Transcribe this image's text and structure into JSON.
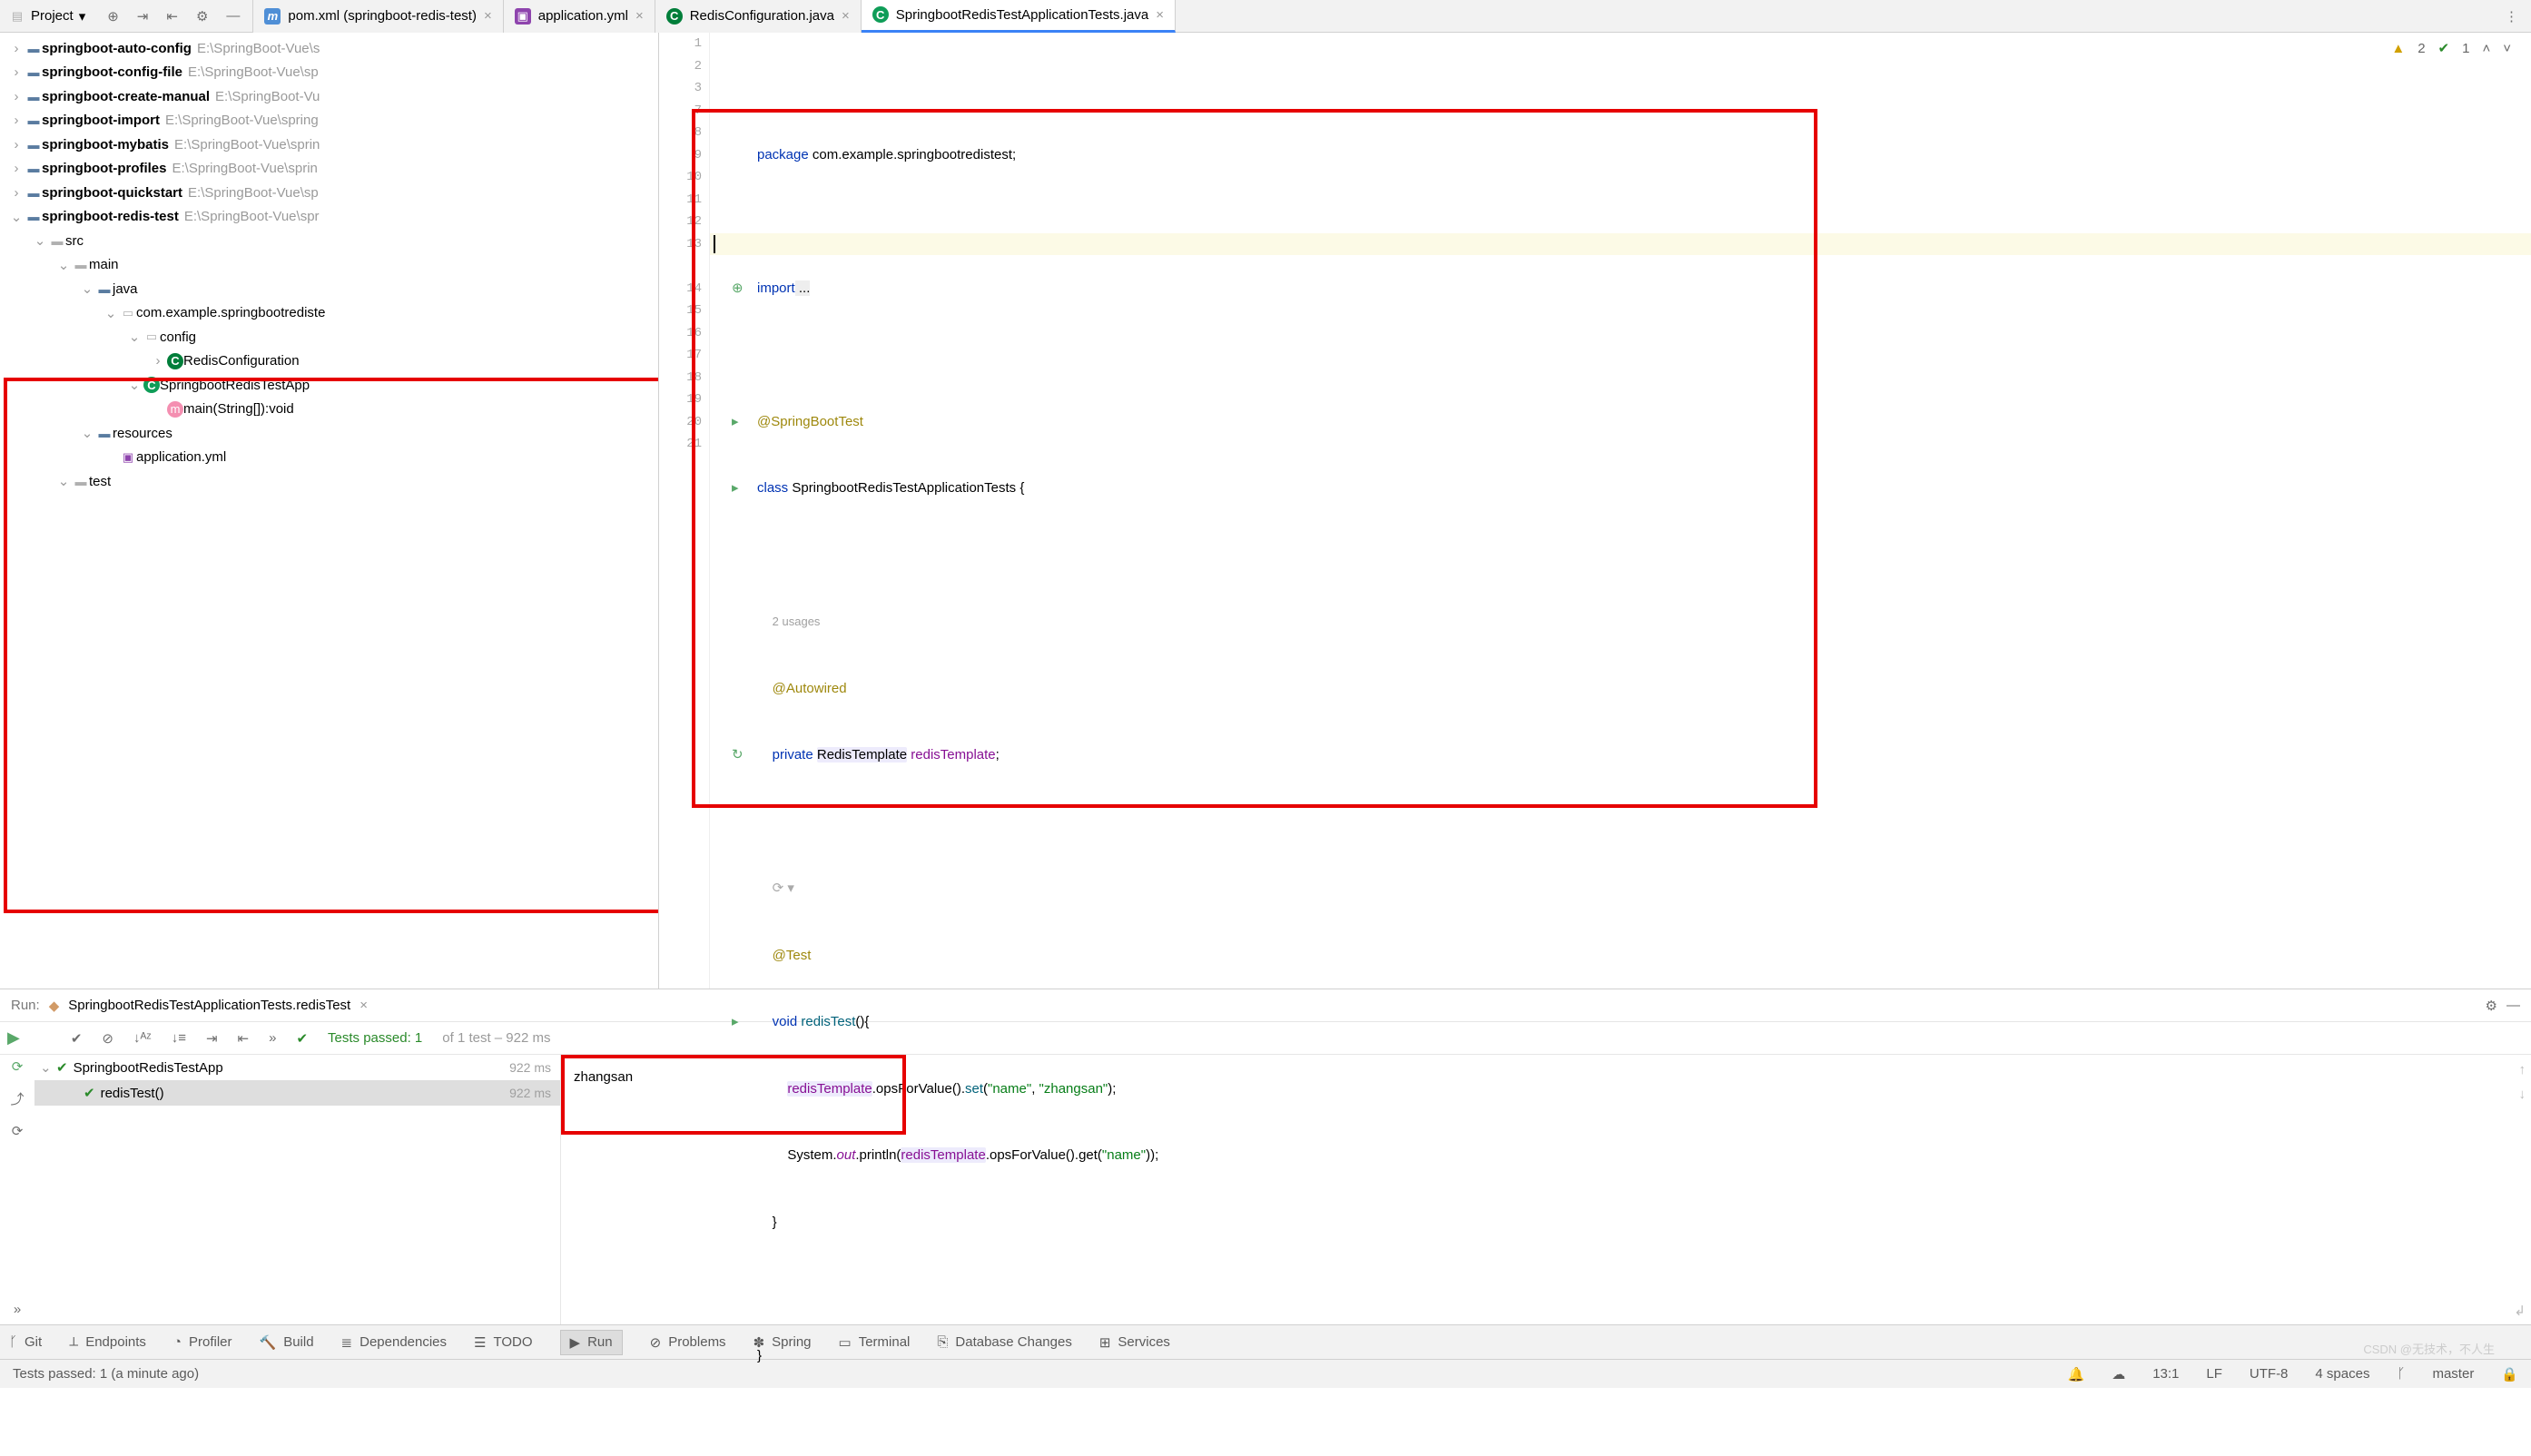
{
  "project": {
    "label": "Project"
  },
  "tabs": [
    {
      "icon": "m",
      "label": "pom.xml (springboot-redis-test)"
    },
    {
      "icon": "y",
      "label": "application.yml"
    },
    {
      "icon": "c",
      "label": "RedisConfiguration.java"
    },
    {
      "icon": "c2",
      "label": "SpringbootRedisTestApplicationTests.java",
      "active": true
    }
  ],
  "tree": [
    {
      "depth": 0,
      "chev": "›",
      "icon": "fold-b",
      "label": "springboot-auto-config",
      "bold": true,
      "hint": "E:\\SpringBoot-Vue\\s"
    },
    {
      "depth": 0,
      "chev": "›",
      "icon": "fold-b",
      "label": "springboot-config-file",
      "bold": true,
      "hint": "E:\\SpringBoot-Vue\\sp"
    },
    {
      "depth": 0,
      "chev": "›",
      "icon": "fold-b",
      "label": "springboot-create-manual",
      "bold": true,
      "hint": "E:\\SpringBoot-Vu"
    },
    {
      "depth": 0,
      "chev": "›",
      "icon": "fold-b",
      "label": "springboot-import",
      "bold": true,
      "hint": "E:\\SpringBoot-Vue\\spring"
    },
    {
      "depth": 0,
      "chev": "›",
      "icon": "fold-b",
      "label": "springboot-mybatis",
      "bold": true,
      "hint": "E:\\SpringBoot-Vue\\sprin"
    },
    {
      "depth": 0,
      "chev": "›",
      "icon": "fold-b",
      "label": "springboot-profiles",
      "bold": true,
      "hint": "E:\\SpringBoot-Vue\\sprin"
    },
    {
      "depth": 0,
      "chev": "›",
      "icon": "fold-b",
      "label": "springboot-quickstart",
      "bold": true,
      "hint": "E:\\SpringBoot-Vue\\sp"
    },
    {
      "depth": 0,
      "chev": "⌄",
      "icon": "fold-b",
      "label": "springboot-redis-test",
      "bold": true,
      "hint": "E:\\SpringBoot-Vue\\spr"
    },
    {
      "depth": 1,
      "chev": "⌄",
      "icon": "fold",
      "label": "src"
    },
    {
      "depth": 2,
      "chev": "⌄",
      "icon": "fold",
      "label": "main"
    },
    {
      "depth": 3,
      "chev": "⌄",
      "icon": "fold-b",
      "label": "java"
    },
    {
      "depth": 4,
      "chev": "⌄",
      "icon": "pkg",
      "label": "com.example.springbootrediste"
    },
    {
      "depth": 5,
      "chev": "⌄",
      "icon": "pkg",
      "label": "config"
    },
    {
      "depth": 6,
      "chev": "›",
      "icon": "c",
      "label": "RedisConfiguration"
    },
    {
      "depth": 5,
      "chev": "⌄",
      "icon": "c2",
      "label": "SpringbootRedisTestApp"
    },
    {
      "depth": 6,
      "chev": "",
      "icon": "mth",
      "label": "main(String[]):void"
    },
    {
      "depth": 3,
      "chev": "⌄",
      "icon": "fold-b",
      "label": "resources"
    },
    {
      "depth": 4,
      "chev": "",
      "icon": "y",
      "label": "application.yml"
    },
    {
      "depth": 2,
      "chev": "⌄",
      "icon": "fold",
      "label": "test"
    }
  ],
  "gutter_lines": [
    "1",
    "2",
    "3",
    "7",
    "8",
    "9",
    "10",
    "11",
    "12",
    "13",
    "",
    "14",
    "15",
    "16",
    "17",
    "18",
    "19",
    "20",
    "21"
  ],
  "code": {
    "package_kw": "package",
    "package": " com.example.springbootredistest;",
    "import_kw": "import",
    "import_dots": " ...",
    "ann_sbt": "@SpringBootTest",
    "class_kw": "class ",
    "class_name": "SpringbootRedisTestApplicationTests {",
    "usages": "2 usages",
    "ann_aw": "@Autowired",
    "private_kw": "private ",
    "rt_type": "RedisTemplate",
    "rt_name": " redisTemplate",
    "semi": ";",
    "ann_test": "@Test",
    "void_kw": "void ",
    "method": "redisTest",
    "paren_brace": "(){",
    "rt_call": "redisTemplate",
    "ofv": ".opsForValue().",
    "set_m": "set",
    "set_args_open": "(",
    "str_name": "\"name\"",
    "comma": ", ",
    "str_zhang": "\"zhangsan\"",
    "set_close": ");",
    "sys": "System.",
    "out": "out",
    "println": ".println(",
    "rt_call2": "redisTemplate",
    "ofv2": ".opsForValue().get(",
    "str_name2": "\"name\"",
    "close2": "));",
    "brace1": "}",
    "brace2": "}"
  },
  "inspection": {
    "warn_count": "2",
    "ok_count": "1"
  },
  "run": {
    "head_label": "Run:",
    "config": "SpringbootRedisTestApplicationTests.redisTest",
    "tests_passed_prefix": "Tests passed: ",
    "tests_passed_n": "1",
    "tests_passed_suffix": " of 1 test – 922 ms",
    "tree": [
      {
        "label": "SpringbootRedisTestApp",
        "dur": "922 ms"
      },
      {
        "label": "redisTest()",
        "dur": "922 ms",
        "sel": true
      }
    ],
    "output": "zhangsan"
  },
  "bottom": [
    "Git",
    "Endpoints",
    "Profiler",
    "Build",
    "Dependencies",
    "TODO",
    "Run",
    "Problems",
    "Spring",
    "Terminal",
    "Database Changes",
    "Services"
  ],
  "status": {
    "left": "Tests passed: 1 (a minute ago)",
    "pos": "13:1",
    "le": "LF",
    "enc": "UTF-8",
    "indent": "4 spaces",
    "branch": "master"
  },
  "watermark": "CSDN @无技术，不人生"
}
